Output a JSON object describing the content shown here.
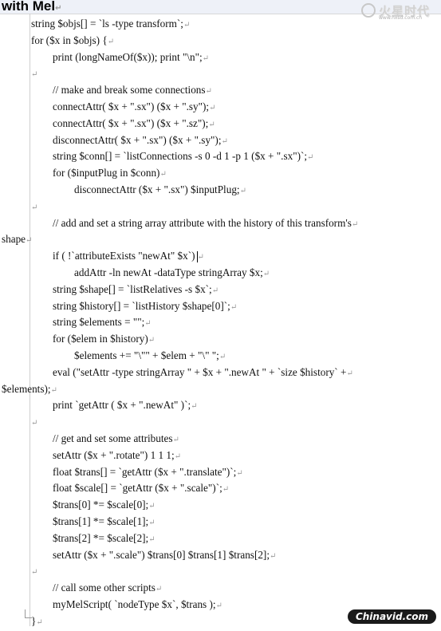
{
  "header": {
    "title": "with Mel",
    "logo_text": "火星时代",
    "logo_url": "www.hxsd.com.cn"
  },
  "code_lines": [
    {
      "indent": 0,
      "text": "string $objs[] = `ls -type transform`;"
    },
    {
      "indent": 0,
      "text": "for ($x in $objs) {"
    },
    {
      "indent": 1,
      "text": "print (longNameOf($x)); print \"\\n\";"
    },
    {
      "indent": 0,
      "text": ""
    },
    {
      "indent": 1,
      "text": "// make and break some connections"
    },
    {
      "indent": 1,
      "text": "connectAttr( $x + \".sx\") ($x + \".sy\");"
    },
    {
      "indent": 1,
      "text": "connectAttr( $x + \".sx\") ($x + \".sz\");"
    },
    {
      "indent": 1,
      "text": "disconnectAttr( $x + \".sx\") ($x + \".sy\");"
    },
    {
      "indent": 1,
      "text": "string $conn[] = `listConnections -s 0 -d 1 -p 1 ($x + \".sx\")`;"
    },
    {
      "indent": 1,
      "text": "for ($inputPlug in $conn)"
    },
    {
      "indent": 2,
      "text": "disconnectAttr ($x + \".sx\") $inputPlug;"
    },
    {
      "indent": 0,
      "text": ""
    },
    {
      "indent": 1,
      "text": "// add and set a string array attribute with the history of this transform's"
    },
    {
      "indent": -1,
      "text": "shape"
    },
    {
      "indent": 1,
      "text": "if ( !`attributeExists \"newAt\" $x`)",
      "cursor": true
    },
    {
      "indent": 2,
      "text": "addAttr -ln newAt -dataType stringArray $x;"
    },
    {
      "indent": 1,
      "text": "string $shape[] = `listRelatives -s $x`;"
    },
    {
      "indent": 1,
      "text": "string $history[] = `listHistory $shape[0]`;"
    },
    {
      "indent": 1,
      "text": "string $elements = \"\";"
    },
    {
      "indent": 1,
      "text": "for ($elem in $history)"
    },
    {
      "indent": 2,
      "text": "$elements += \"\\\"\" + $elem + \"\\\" \";"
    },
    {
      "indent": 1,
      "text": "eval (\"setAttr -type stringArray \" + $x + \".newAt \" + `size $history` +"
    },
    {
      "indent": -1,
      "text": "$elements);"
    },
    {
      "indent": 1,
      "text": "print `getAttr ( $x + \".newAt\" )`;"
    },
    {
      "indent": 0,
      "text": ""
    },
    {
      "indent": 1,
      "text": "// get and set some attributes"
    },
    {
      "indent": 1,
      "text": "setAttr ($x + \".rotate\") 1 1 1;"
    },
    {
      "indent": 1,
      "text": "float $trans[] = `getAttr ($x + \".translate\")`;"
    },
    {
      "indent": 1,
      "text": "float $scale[] = `getAttr ($x + \".scale\")`;"
    },
    {
      "indent": 1,
      "text": "$trans[0] *= $scale[0];"
    },
    {
      "indent": 1,
      "text": "$trans[1] *= $scale[1];"
    },
    {
      "indent": 1,
      "text": "$trans[2] *= $scale[2];"
    },
    {
      "indent": 1,
      "text": "setAttr ($x + \".scale\") $trans[0] $trans[1] $trans[2];"
    },
    {
      "indent": 0,
      "text": ""
    },
    {
      "indent": 1,
      "text": "// call some other scripts"
    },
    {
      "indent": 1,
      "text": "myMelScript( `nodeType $x`, $trans );"
    },
    {
      "indent": 0,
      "text": "}"
    }
  ],
  "paragraph_mark": "↵",
  "footer": {
    "watermark": "Chinavid.com"
  }
}
